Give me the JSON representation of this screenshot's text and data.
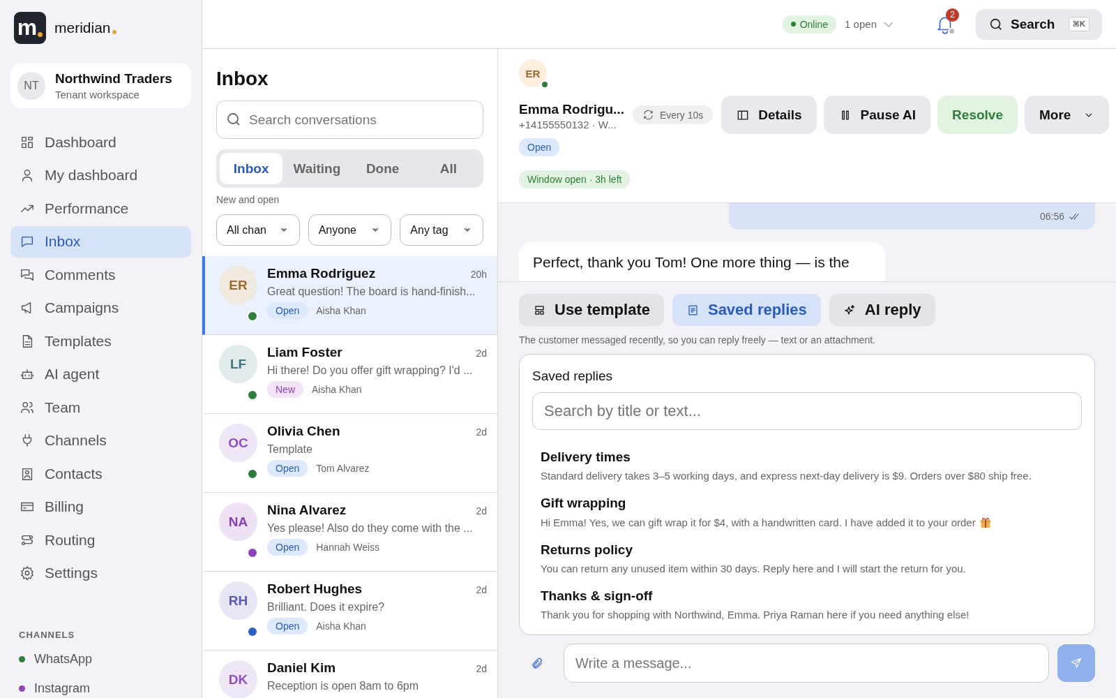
{
  "brand": {
    "logo_letter": "m",
    "name": "meridian"
  },
  "workspace": {
    "initials": "NT",
    "name": "Northwind Traders",
    "subtitle": "Tenant workspace"
  },
  "nav": [
    {
      "label": "Dashboard",
      "selected": false
    },
    {
      "label": "My dashboard",
      "selected": false
    },
    {
      "label": "Performance",
      "selected": false
    },
    {
      "label": "Inbox",
      "selected": true
    },
    {
      "label": "Comments",
      "selected": false
    },
    {
      "label": "Campaigns",
      "selected": false
    },
    {
      "label": "Templates",
      "selected": false
    },
    {
      "label": "AI agent",
      "selected": false
    },
    {
      "label": "Team",
      "selected": false
    },
    {
      "label": "Channels",
      "selected": false
    },
    {
      "label": "Contacts",
      "selected": false
    },
    {
      "label": "Billing",
      "selected": false
    },
    {
      "label": "Routing",
      "selected": false
    },
    {
      "label": "Settings",
      "selected": false
    }
  ],
  "channels": {
    "heading": "CHANNELS",
    "items": [
      {
        "label": "WhatsApp",
        "color": "#2e7d3a"
      },
      {
        "label": "Instagram",
        "color": "#8e44b8"
      }
    ]
  },
  "topbar": {
    "status": "Online",
    "open_count": "1 open",
    "notifications": "2",
    "search": {
      "label": "Search",
      "shortcut": "⌘K"
    }
  },
  "inbox": {
    "title": "Inbox",
    "search_placeholder": "Search conversations",
    "tabs": [
      {
        "label": "Inbox",
        "selected": true
      },
      {
        "label": "Waiting",
        "selected": false
      },
      {
        "label": "Done",
        "selected": false
      },
      {
        "label": "All",
        "selected": false
      }
    ],
    "subtitle": "New and open",
    "filters": [
      {
        "label": "All chan"
      },
      {
        "label": "Anyone"
      },
      {
        "label": "Any tag"
      }
    ],
    "conversations": [
      {
        "initials": "ER",
        "name": "Emma Rodriguez",
        "time": "20h",
        "preview": "Great question! The board is hand-finish...",
        "status": {
          "label": "Open",
          "kind": "open"
        },
        "assignee": "Aisha Khan",
        "color": "#2e7d3a",
        "selected": true
      },
      {
        "initials": "LF",
        "name": "Liam Foster",
        "time": "2d",
        "preview": "Hi there! Do you offer gift wrapping? I'd ...",
        "status": {
          "label": "New",
          "kind": "new"
        },
        "assignee": "Aisha Khan",
        "color": "#2e7d3a",
        "selected": false
      },
      {
        "initials": "OC",
        "name": "Olivia Chen",
        "time": "2d",
        "preview": "Template",
        "status": {
          "label": "Open",
          "kind": "open"
        },
        "assignee": "Tom Alvarez",
        "color": "#2e7d3a",
        "selected": false
      },
      {
        "initials": "NA",
        "name": "Nina Alvarez",
        "time": "2d",
        "preview": "Yes please! Also do they come with the ...",
        "status": {
          "label": "Open",
          "kind": "open"
        },
        "assignee": "Hannah Weiss",
        "color": "#8e44b8",
        "selected": false
      },
      {
        "initials": "RH",
        "name": "Robert Hughes",
        "time": "2d",
        "preview": "Brilliant. Does it expire?",
        "status": {
          "label": "Open",
          "kind": "open"
        },
        "assignee": "Aisha Khan",
        "color": "#2a5fc4",
        "selected": false
      },
      {
        "initials": "DK",
        "name": "Daniel Kim",
        "time": "2d",
        "preview": "Reception is open 8am to 6pm"
      }
    ]
  },
  "conversation": {
    "initials": "ER",
    "online": true,
    "name": "Emma Rodrigu...",
    "subtitle": "+14155550132 · W...",
    "refresh": "Every 10s",
    "status": "Open",
    "window": "Window open · 3h left",
    "actions": [
      {
        "label": "Details",
        "kind": "details"
      },
      {
        "label": "Pause AI",
        "kind": "pause"
      },
      {
        "label": "Resolve",
        "kind": "resolve"
      },
      {
        "label": "More",
        "kind": "more"
      }
    ],
    "messages": [
      {
        "kind": "outgoing",
        "time": "06:56",
        "read": true
      },
      {
        "kind": "incoming",
        "text": "Perfect, thank you Tom! One more thing — is the"
      }
    ]
  },
  "composer": {
    "tools": [
      {
        "label": "Use template",
        "kind": "template",
        "selected": false
      },
      {
        "label": "Saved replies",
        "kind": "saved",
        "selected": true
      },
      {
        "label": "AI reply",
        "kind": "ai",
        "selected": false
      }
    ],
    "hint": "The customer messaged recently, so you can reply freely — text or an attachment.",
    "saved_replies": {
      "title": "Saved replies",
      "search_placeholder": "Search by title or text...",
      "items": [
        {
          "title": "Delivery times",
          "body": "Standard delivery takes 3–5 working days, and express next-day delivery is $9. Orders over $80 ship free.",
          "gift_icon": false
        },
        {
          "title": "Gift wrapping",
          "body": "Hi Emma! Yes, we can gift wrap it for $4, with a handwritten card. I have added it to your order",
          "gift_icon": true
        },
        {
          "title": "Returns policy",
          "body": "You can return any unused item within 30 days. Reply here and I will start the return for you.",
          "gift_icon": false
        },
        {
          "title": "Thanks & sign-off",
          "body": "Thank you for shopping with Northwind, Emma. Priya Raman here if you need anything else!",
          "gift_icon": false
        }
      ]
    },
    "message_placeholder": "Write a message..."
  }
}
